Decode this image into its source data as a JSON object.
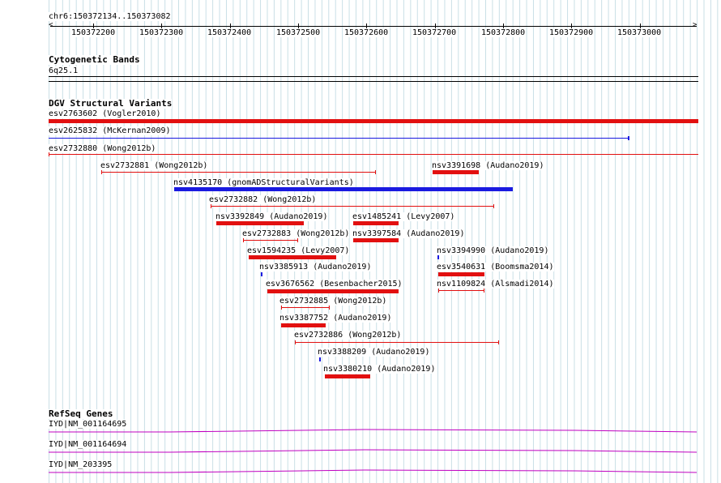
{
  "ruler": {
    "location": "chr6:150372134..150373082",
    "ticks": [
      "150372200",
      "150372300",
      "150372400",
      "150372500",
      "150372600",
      "150372700",
      "150372800",
      "150372900",
      "150373000"
    ]
  },
  "cytoband": {
    "title": "Cytogenetic Bands",
    "band": "6q25.1"
  },
  "dgv": {
    "title": "DGV Structural Variants",
    "colors": {
      "loss": "#e21010",
      "gain": "#1a1ae0"
    },
    "features": [
      {
        "label": "esv2763602 (Vogler2010)"
      },
      {
        "label": "esv2625832 (McKernan2009)"
      },
      {
        "label": "esv2732880 (Wong2012b)"
      },
      {
        "label": "esv2732881 (Wong2012b)"
      },
      {
        "label": "nsv3391698 (Audano2019)"
      },
      {
        "label": "nsv4135170 (gnomADStructuralVariants)"
      },
      {
        "label": "esv2732882 (Wong2012b)"
      },
      {
        "label": "nsv3392849 (Audano2019)"
      },
      {
        "label": "esv1485241 (Levy2007)"
      },
      {
        "label": "esv2732883 (Wong2012b)"
      },
      {
        "label": "nsv3397584 (Audano2019)"
      },
      {
        "label": "esv1594235 (Levy2007)"
      },
      {
        "label": "nsv3394990 (Audano2019)"
      },
      {
        "label": "nsv3385913 (Audano2019)"
      },
      {
        "label": "esv3540631 (Boomsma2014)"
      },
      {
        "label": "esv3676562 (Besenbacher2015)"
      },
      {
        "label": "nsv1109824 (Alsmadi2014)"
      },
      {
        "label": "esv2732885 (Wong2012b)"
      },
      {
        "label": "nsv3387752 (Audano2019)"
      },
      {
        "label": "esv2732886 (Wong2012b)"
      },
      {
        "label": "nsv3388209 (Audano2019)"
      },
      {
        "label": "nsv3380210 (Audano2019)"
      }
    ]
  },
  "refseq": {
    "title": "RefSeq Genes",
    "color": "#c000c0",
    "genes": [
      {
        "label": "IYD|NM_001164695"
      },
      {
        "label": "IYD|NM_001164694"
      },
      {
        "label": "IYD|NM_203395"
      }
    ]
  }
}
